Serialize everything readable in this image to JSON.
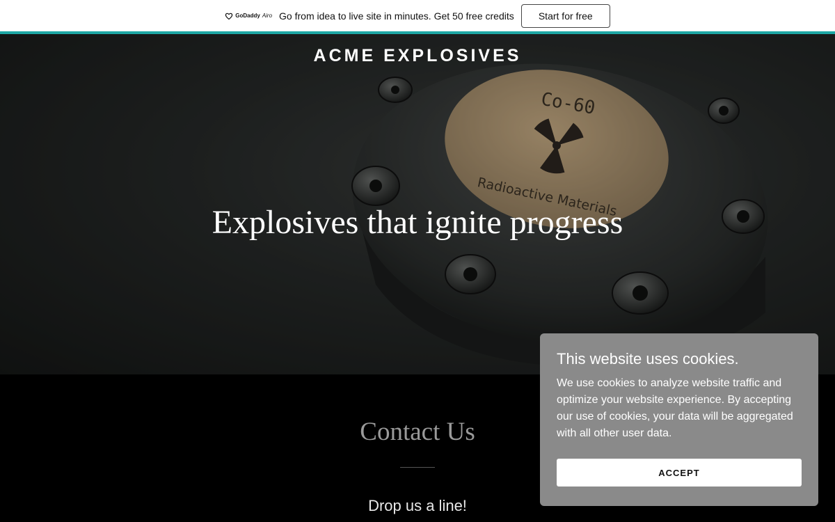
{
  "promo": {
    "brand": "GoDaddy",
    "brand_suffix": "Airo",
    "message": "Go from idea to live site in minutes. Get 50 free credits",
    "cta_label": "Start for free",
    "accent_color": "#1ea7a5"
  },
  "hero": {
    "site_title": "ACME EXPLOSIVES",
    "headline": "Explosives that ignite progress",
    "image": {
      "subject": "radioactive-canister",
      "label_line1": "Co-60",
      "label_line2": "Radioactive Materials"
    }
  },
  "contact": {
    "title": "Contact Us",
    "subtitle": "Drop us a line!"
  },
  "cookie_banner": {
    "title": "This website uses cookies.",
    "body": "We use cookies to analyze website traffic and optimize your website experience. By accepting our use of cookies, your data will be aggregated with all other user data.",
    "accept_label": "ACCEPT"
  }
}
